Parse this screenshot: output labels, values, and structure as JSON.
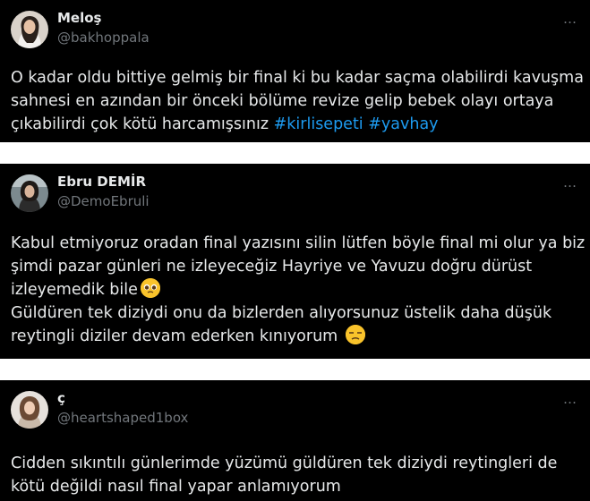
{
  "tweets": [
    {
      "name": "Meloş",
      "handle": "@bakhoppala",
      "more_icon": "…",
      "lines": [
        "O kadar oldu bittiye gelmiş bir final ki bu kadar saçma olabilirdi kavuşma",
        "sahnesi en azından bir önceki bölüme revize gelip bebek olayı ortaya",
        "çıkabilirdi çok kötü harcamışsınız"
      ],
      "hashtags": [
        "#kirlisepeti",
        "#yavhay"
      ]
    },
    {
      "name": "Ebru DEMİR",
      "handle": "@DemoEbruli",
      "more_icon": "…",
      "lines": [
        "Kabul etmiyoruz oradan final yazısını silin lütfen böyle final mi olur ya biz",
        "şimdi pazar günleri ne izleyeceğiz Hayriye ve Yavuzu doğru dürüst",
        "izleyemedik bile",
        "Güldüren tek diziydi onu da bizlerden alıyorsunuz üstelik daha düşük",
        "reytingli diziler devam ederken kınıyorum"
      ],
      "emojis": [
        "pleading-face",
        "unamused-face"
      ]
    },
    {
      "name": "ç",
      "handle": "@heartshaped1box",
      "more_icon": "…",
      "lines": [
        "Cidden sıkıntılı günlerimde yüzümü güldüren tek diziydi reytingleri de",
        "kötü değildi nasıl final yapar anlamıyorum"
      ]
    }
  ],
  "colors": {
    "background": "#000000",
    "text": "#e7e9ea",
    "muted": "#71767b",
    "link": "#1d9bf0",
    "separator": "#ffffff"
  }
}
